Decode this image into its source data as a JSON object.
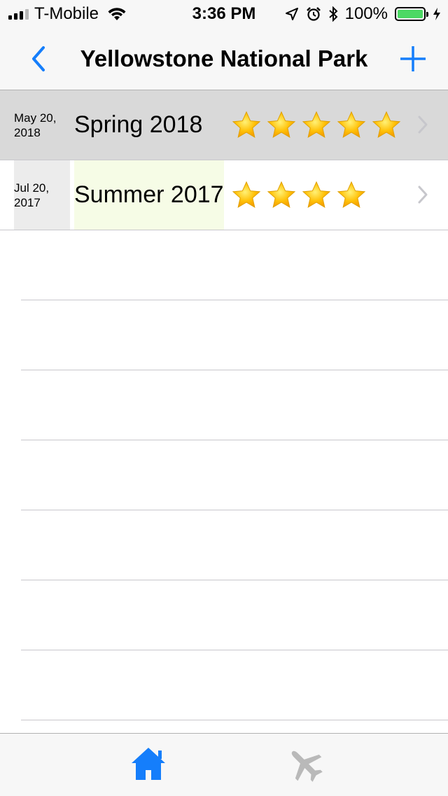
{
  "status_bar": {
    "carrier": "T-Mobile",
    "time": "3:36 PM",
    "battery_text": "100%",
    "battery_level": 1.0,
    "battery_color": "#4cd964",
    "icons": [
      "signal-icon",
      "wifi-icon",
      "location-arrow-icon",
      "alarm-icon",
      "bluetooth-icon",
      "charging-bolt-icon"
    ]
  },
  "nav": {
    "title": "Yellowstone National Park",
    "back_icon": "chevron-left-icon",
    "add_icon": "plus-icon",
    "accent_color": "#157efb"
  },
  "trips": [
    {
      "date_line1": "May 20,",
      "date_line2": "2018",
      "season": "Spring 2018",
      "rating": 5,
      "selected": true
    },
    {
      "date_line1": "Jul 20,",
      "date_line2": "2017",
      "season": "Summer 2017",
      "rating": 4,
      "selected": false
    }
  ],
  "empty_rows": 7,
  "tab_bar": {
    "items": [
      {
        "name": "home",
        "icon": "house-icon",
        "active": true
      },
      {
        "name": "trips",
        "icon": "airplane-icon",
        "active": false
      }
    ],
    "active_color": "#157efb",
    "inactive_color": "#b9b9b9"
  },
  "colors": {
    "star_fill": "#ffc107",
    "selected_row": "#d9d9d9",
    "date_cell_bg": "#ececec",
    "season_cell_bg": "#f6fce6"
  }
}
